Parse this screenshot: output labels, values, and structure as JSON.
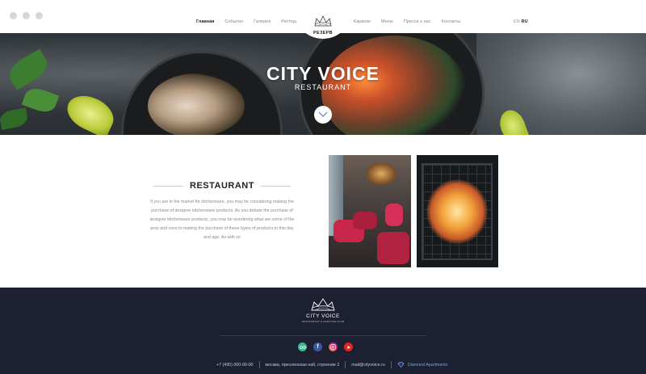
{
  "nav": {
    "left": [
      "Главная",
      "События",
      "Галерея",
      "Ресторан"
    ],
    "right": [
      "Караоке",
      "Меню",
      "Пресса о нас",
      "Контакты"
    ],
    "reserve_label": "РЕЗЕРВ",
    "lang": {
      "en": "EN",
      "ru": "RU",
      "current": "RU"
    }
  },
  "hero": {
    "title": "CITY VOICE",
    "subtitle": "RESTAURANT"
  },
  "about": {
    "title": "RESTAURANT",
    "text": "If you are in the market for kitchenware, you may be considering making the purchase of designer kitchenware products. As you debate the purchase of designer kitchenware products, you may be wondering what are some of the pros and cons to making the purchase of these types of products in this day and age. As with so"
  },
  "footer": {
    "brand": "CITY VOICE",
    "tagline": "RESTAURANT & KARAOKE CLUB",
    "socials": [
      "tripadvisor-icon",
      "facebook-icon",
      "instagram-icon",
      "youtube-icon"
    ],
    "phone": "+7 (495) 000-00-00",
    "address": "москва, пресненская наб, строение 2",
    "email": "mail@cityvoice.ru",
    "partner": "Diamond Apartments"
  },
  "colors": {
    "footer_bg": "#1d2030",
    "accent_partner": "#7ea3e6"
  }
}
